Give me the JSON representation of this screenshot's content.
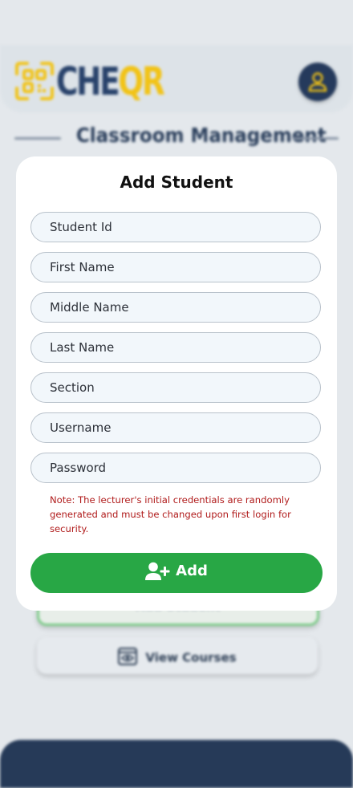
{
  "header": {
    "logo_text_main": "CHE",
    "logo_text_accent": "QR"
  },
  "page": {
    "section_title": "Classroom Management"
  },
  "background_buttons": {
    "partial_label": "Add Student",
    "view_courses_label": "View Courses"
  },
  "modal": {
    "title": "Add Student",
    "fields": {
      "student_id": {
        "placeholder": "Student Id",
        "value": ""
      },
      "first_name": {
        "placeholder": "First Name",
        "value": ""
      },
      "middle_name": {
        "placeholder": "Middle Name",
        "value": ""
      },
      "last_name": {
        "placeholder": "Last Name",
        "value": ""
      },
      "section": {
        "placeholder": "Section",
        "value": ""
      },
      "username": {
        "placeholder": "Username",
        "value": ""
      },
      "password": {
        "placeholder": "Password",
        "value": ""
      }
    },
    "note": "Note: The lecturer's initial credentials are randomly generated and must be changed upon first login for security.",
    "add_button_label": "Add"
  },
  "colors": {
    "brand_navy": "#263a58",
    "brand_yellow": "#f2c315",
    "success_green": "#28a745",
    "warning_red": "#b01b1b"
  },
  "icons": {
    "logo": "qr-code-icon",
    "profile": "user-icon",
    "add": "user-plus-icon",
    "courses": "eye-icon"
  }
}
